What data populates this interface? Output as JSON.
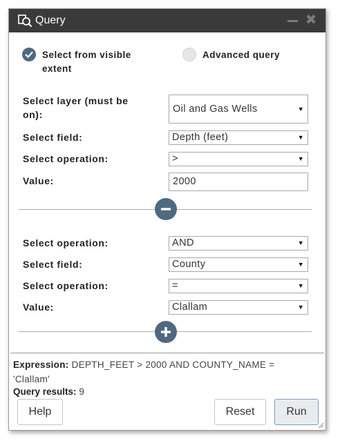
{
  "window": {
    "title": "Query",
    "title_icon": "query-icon",
    "minimize_icon": "minimize-icon",
    "close_icon": "close-icon",
    "close_glyph": "✖"
  },
  "mode": {
    "options": [
      {
        "label": "Select from visible extent",
        "line1": "Select from visible",
        "line2": "extent",
        "checked": true
      },
      {
        "label": "Advanced query",
        "checked": false
      }
    ]
  },
  "form": {
    "layer_label": "Select layer (must be on):",
    "layer_label_line1": "Select layer (must be",
    "layer_label_line2": "on):",
    "layer_value": "Oil and Gas Wells",
    "field_label": "Select field:",
    "field_value": "Depth (feet)",
    "operation_label": "Select operation:",
    "operation_value": ">",
    "value_label": "Value:",
    "value_value": "2000"
  },
  "remove_clause_icon": "minus-circle-icon",
  "clause2": {
    "join_label": "Select operation:",
    "join_value": "AND",
    "field_label": "Select field:",
    "field_value": "County",
    "operation_label": "Select operation:",
    "operation_value": "=",
    "value_label": "Value:",
    "value_value": "Clallam"
  },
  "add_clause_icon": "plus-circle-icon",
  "footer": {
    "expression_label": "Expression:",
    "expression_line1": "DEPTH_FEET > 2000 AND COUNTY_NAME =",
    "expression_line2": "'Clallam'",
    "results_label": "Query results:",
    "results_value": "9",
    "help_label": "Help",
    "reset_label": "Reset",
    "run_label": "Run"
  },
  "colors": {
    "titlebar": "#3a3a3a",
    "accent": "#4f6a80",
    "run_border": "#7a9bb8"
  }
}
